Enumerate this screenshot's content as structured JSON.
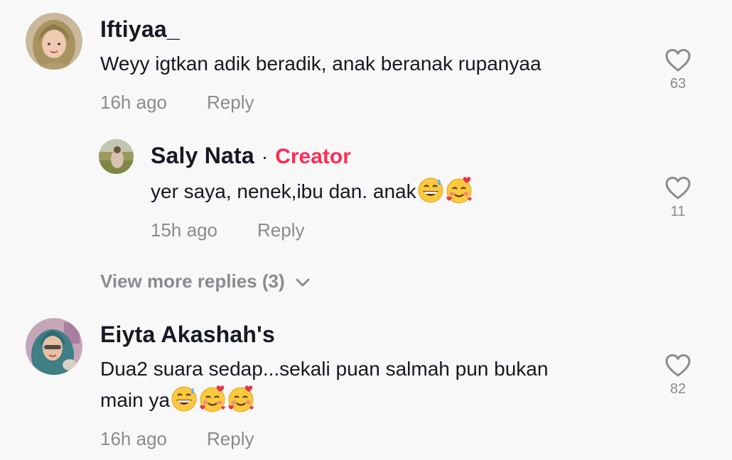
{
  "comments": [
    {
      "username": "Iftiyaa_",
      "text": "Weyy igtkan adik beradik, anak beranak rupanyaa",
      "time": "16h ago",
      "reply_label": "Reply",
      "likes": "63",
      "reply": {
        "username": "Saly Nata",
        "separator": "·",
        "badge": "Creator",
        "text": "yer saya, nenek,ibu dan. anak",
        "emojis": [
          "grinning-sweat-emoji",
          "smiling-hearts-emoji"
        ],
        "time": "15h ago",
        "reply_label": "Reply",
        "likes": "11"
      },
      "view_more": "View more replies (3)"
    },
    {
      "username": "Eiyta Akashah's",
      "text_line1": "Dua2 suara sedap...sekali puan salmah pun bukan",
      "text_line2": "main ya",
      "emojis": [
        "grinning-sweat-emoji",
        "smiling-hearts-emoji",
        "smiling-hearts-emoji"
      ],
      "time": "16h ago",
      "reply_label": "Reply",
      "likes": "82"
    }
  ],
  "icons": {
    "like": "heart-outline-icon",
    "expand": "chevron-down-icon"
  },
  "colors": {
    "background": "#f8f8f8",
    "text": "#161823",
    "muted": "#8a8b91",
    "creator": "#fe2c55"
  }
}
